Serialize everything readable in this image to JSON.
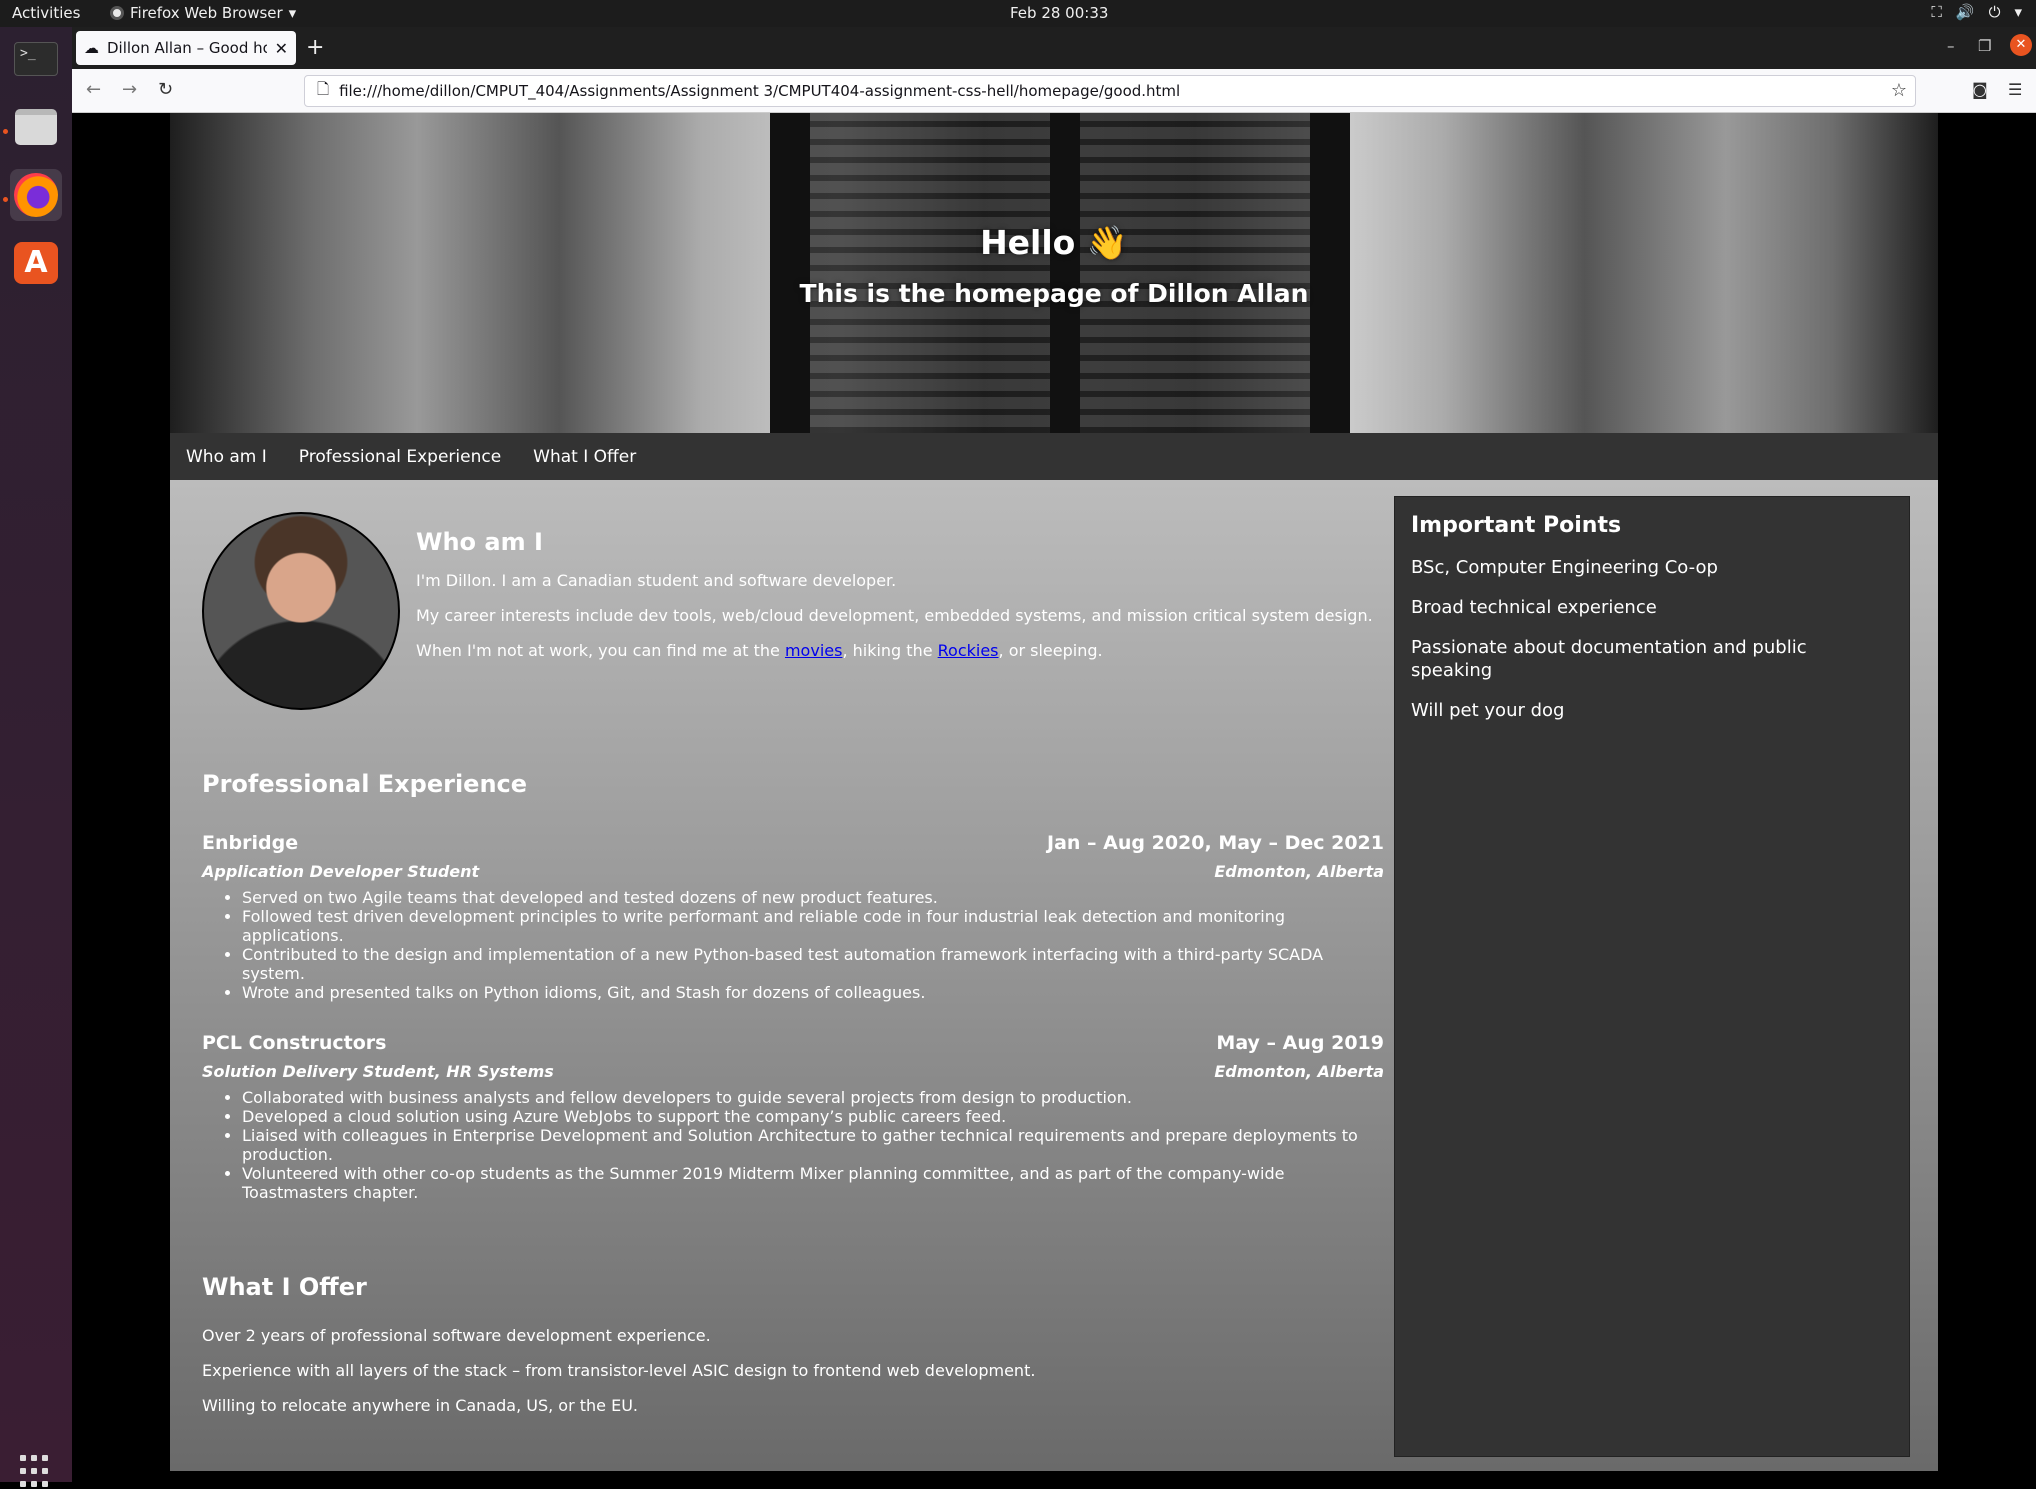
{
  "topbar": {
    "activities": "Activities",
    "app_name": "Firefox Web Browser",
    "clock": "Feb 28  00:33"
  },
  "browser": {
    "tab_title": "Dillon Allan – Good homepage",
    "url": "file:///home/dillon/CMPUT_404/Assignments/Assignment 3/CMPUT404-assignment-css-hell/homepage/good.html"
  },
  "hero": {
    "title": "Hello 👋",
    "subtitle": "This is the homepage of Dillon Allan"
  },
  "nav": [
    "Who am I",
    "Professional Experience",
    "What I Offer"
  ],
  "about": {
    "heading": "Who am I",
    "p1": "I'm Dillon. I am a Canadian student and software developer.",
    "p2": "My career interests include dev tools, web/cloud development, embedded systems, and mission critical system design.",
    "p3_before": "When I'm not at work, you can find me at the ",
    "link_movies": "movies",
    "p3_middle": ", hiking the ",
    "link_rockies": "Rockies",
    "p3_after": ", or sleeping."
  },
  "experience": {
    "heading": "Professional Experience",
    "jobs": [
      {
        "company": "Enbridge",
        "dates": "Jan – Aug 2020, May – Dec 2021",
        "role": "Application Developer Student",
        "location": "Edmonton, Alberta",
        "bullets": [
          "Served on two Agile teams that developed and tested dozens of new product features.",
          "Followed test driven development principles to write performant and reliable code in four industrial leak detection and monitoring applications.",
          "Contributed to the design and implementation of a new Python-based test automation framework interfacing with a third-party SCADA system.",
          "Wrote and presented talks on Python idioms, Git, and Stash for dozens of colleagues."
        ]
      },
      {
        "company": "PCL Constructors",
        "dates": "May – Aug 2019",
        "role": "Solution Delivery Student, HR Systems",
        "location": "Edmonton, Alberta",
        "bullets": [
          "Collaborated with business analysts and fellow developers to guide several projects from design to production.",
          "Developed a cloud solution using Azure WebJobs to support the company’s public careers feed.",
          "Liaised with colleagues in Enterprise Development and Solution Architecture to gather technical requirements and prepare deployments to production.",
          "Volunteered with other co-op students as the Summer 2019 Midterm Mixer planning committee, and as part of the company-wide Toastmasters chapter."
        ]
      }
    ]
  },
  "offer": {
    "heading": "What I Offer",
    "items": [
      "Over 2 years of professional software development experience.",
      "Experience with all layers of the stack – from transistor-level ASIC design to frontend web development.",
      "Willing to relocate anywhere in Canada, US, or the EU."
    ]
  },
  "aside": {
    "heading": "Important Points",
    "points": [
      "BSc, Computer Engineering Co-op",
      "Broad technical experience",
      "Passionate about documentation and public speaking",
      "Will pet your dog"
    ]
  },
  "colors": {
    "nav_bg": "#333333",
    "aside_bg": "#333333",
    "link": "#0000ee",
    "ubuntu_orange": "#e95420"
  }
}
